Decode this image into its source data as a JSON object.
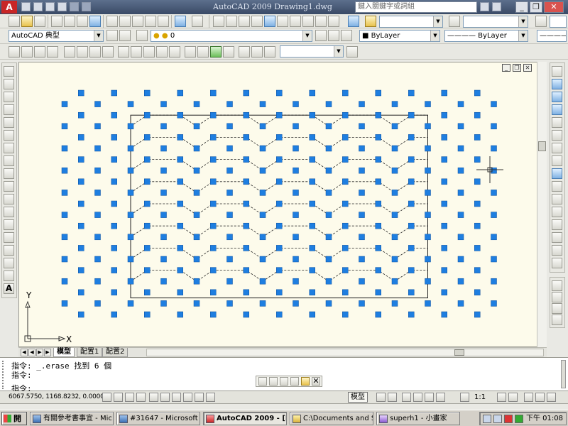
{
  "window": {
    "title": "AutoCAD 2009  Drawing1.dwg",
    "search_placeholder": "鍵入關鍵字或詞組",
    "minimize": "_",
    "restore": "❐",
    "close": "✕"
  },
  "toolbars": {
    "workspace": "AutoCAD 典型",
    "layer": "0",
    "color": "ByLayer",
    "linetype": "———— ByLayer",
    "lineweight": "————"
  },
  "drawing": {
    "ucs_y_label": "Y",
    "ucs_x_label": "X",
    "colors": {
      "background": "#fdfbeb",
      "grip": "#1e7ee0",
      "border": "#222222"
    }
  },
  "layout_tabs": [
    {
      "label": "模型",
      "active": true
    },
    {
      "label": "配置1",
      "active": false
    },
    {
      "label": "配置2",
      "active": false
    }
  ],
  "command": {
    "lines": [
      "指令: _.erase 找到 6 個",
      "指令:",
      "指令:"
    ]
  },
  "status": {
    "coords": "6067.5750, 1168.8232, 0.0000",
    "model_label": "模型",
    "annotation_scale": "1:1"
  },
  "taskbar": {
    "start": "開始",
    "tasks": [
      {
        "label": "有關參考書事宜 - Mic...",
        "active": false
      },
      {
        "label": "#31647 - Microsoft Inte...",
        "active": false
      },
      {
        "label": "AutoCAD 2009 - [Draw...",
        "active": true
      },
      {
        "label": "C:\\Documents and Settin...",
        "active": false
      },
      {
        "label": "superh1 - 小畫家",
        "active": false
      }
    ],
    "clock": "下午 01:08"
  }
}
